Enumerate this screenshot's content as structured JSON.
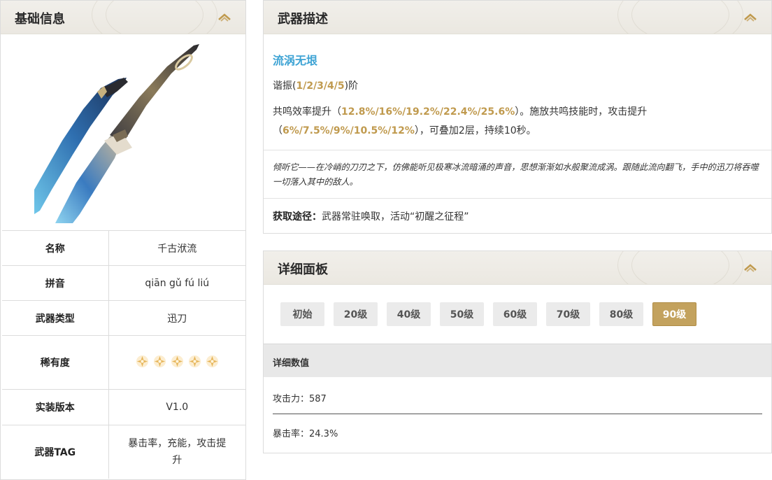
{
  "left_panel": {
    "title": "基础信息",
    "rows": [
      {
        "key": "名称",
        "value": "千古洑流"
      },
      {
        "key": "拼音",
        "value": "qiān gǔ fú liú"
      },
      {
        "key": "武器类型",
        "value": "迅刀"
      },
      {
        "key": "稀有度",
        "stars": 5
      },
      {
        "key": "实装版本",
        "value": "V1.0"
      },
      {
        "key": "武器TAG",
        "value_line1": "暴击率，充能，攻击提",
        "value_line2": "升"
      }
    ]
  },
  "desc_panel": {
    "title": "武器描述",
    "skill_name": "流涡无垠",
    "resonance_prefix": "谐振(",
    "resonance_levels": "1/2/3/4/5",
    "resonance_suffix": ")阶",
    "effect_part1": "共鸣效率提升（",
    "effect_values1": "12.8%/16%/19.2%/22.4%/25.6%",
    "effect_part2": "）。施放共鸣技能时，攻击提升",
    "effect_part3": "（",
    "effect_values2": "6%/7.5%/9%/10.5%/12%",
    "effect_part4": "），可叠加2层，持续10秒。",
    "flavor": "倾听它——在冷峭的刀刃之下，仿佛能听见极寒冰流暗涌的声音，思想渐渐如水般聚流成涡。跟随此流向翻飞，手中的迅刀将吞噬一切落入其中的敌人。",
    "source_label": "获取途径：",
    "source_text": "武器常驻唤取，活动“初醒之征程”"
  },
  "detail_panel": {
    "title": "详细面板",
    "levels": [
      "初始",
      "20级",
      "40级",
      "50级",
      "60级",
      "70级",
      "80级",
      "90级"
    ],
    "active_level": "90级",
    "stats_header": "详细数值",
    "stats": [
      "攻击力：587",
      "暴击率：24.3%"
    ]
  },
  "colors": {
    "accent_gold": "#c3a25e",
    "skill_blue": "#3da3d4",
    "header_bg": "#ebe8e1"
  }
}
